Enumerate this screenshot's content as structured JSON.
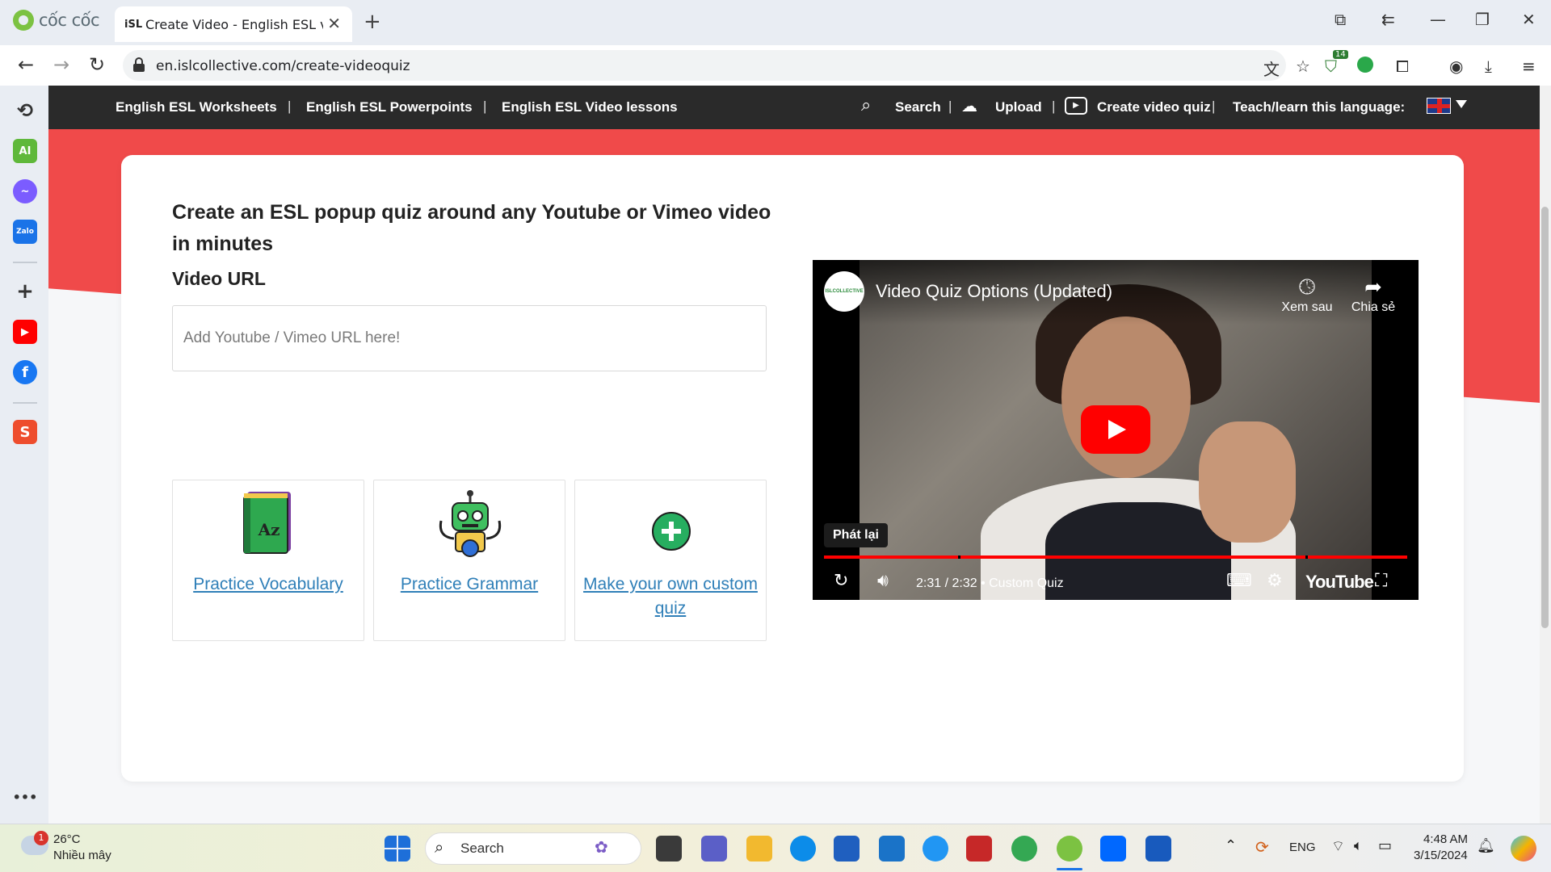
{
  "browser": {
    "brand_name": "cốc cốc",
    "tab_favicon_text": "iSL",
    "tab_title": "Create Video - English ESL video",
    "url": "en.islcollective.com/create-videoquiz",
    "extension_badge": "14"
  },
  "sidebar": {
    "items": [
      {
        "name": "history",
        "icon": "history-icon",
        "color": "#333333"
      },
      {
        "name": "ai",
        "icon": "ai-icon",
        "label": "AI",
        "color": "#5fb83a"
      },
      {
        "name": "messenger",
        "icon": "messenger-icon",
        "color": "#7b5cff"
      },
      {
        "name": "zalo",
        "icon": "zalo-icon",
        "label": "Zalo",
        "color": "#1a73e8"
      },
      {
        "name": "add",
        "icon": "plus-icon",
        "color": "#333333"
      },
      {
        "name": "youtube",
        "icon": "youtube-icon",
        "color": "#ff0000"
      },
      {
        "name": "facebook",
        "icon": "facebook-icon",
        "color": "#1877f2"
      },
      {
        "name": "shopee",
        "icon": "shopee-icon",
        "color": "#ee4d2d"
      }
    ],
    "more": "•••"
  },
  "site_nav": {
    "links": [
      "English ESL Worksheets",
      "English ESL Powerpoints",
      "English ESL Video lessons"
    ],
    "separator": "|",
    "search": "Search",
    "upload": "Upload",
    "create_video_quiz": "Create video quiz",
    "teach_learn": "Teach/learn this language:"
  },
  "main": {
    "headline": "Create an ESL popup quiz around any Youtube or Vimeo video in minutes",
    "url_label": "Video URL",
    "url_placeholder": "Add Youtube / Vimeo URL here!",
    "options": [
      {
        "label": "Practice Vocabulary",
        "icon": "dictionary-book-icon"
      },
      {
        "label": "Practice Grammar",
        "icon": "robot-icon"
      },
      {
        "label": "Make your own custom quiz",
        "icon": "add-circle-icon"
      }
    ]
  },
  "video": {
    "channel_logo_text": "ISLCOLLECTIVE",
    "title": "Video Quiz Options (Updated)",
    "watch_later": "Xem sau",
    "share": "Chia sẻ",
    "replay_tooltip": "Phát lại",
    "time": "2:31 / 2:32",
    "chapter": "• Custom Quiz",
    "youtube_wordmark": "YouTube",
    "progress": 0.99
  },
  "taskbar": {
    "weather_badge": "1",
    "temperature": "26°C",
    "weather_desc": "Nhiều mây",
    "search": "Search",
    "language": "ENG",
    "time": "4:48 AM",
    "date": "3/15/2024"
  },
  "colors": {
    "brand_red": "#f04a4a",
    "nav_bg": "#2a2a2a",
    "link_blue": "#2f7fb8",
    "green": "#27ae60"
  }
}
